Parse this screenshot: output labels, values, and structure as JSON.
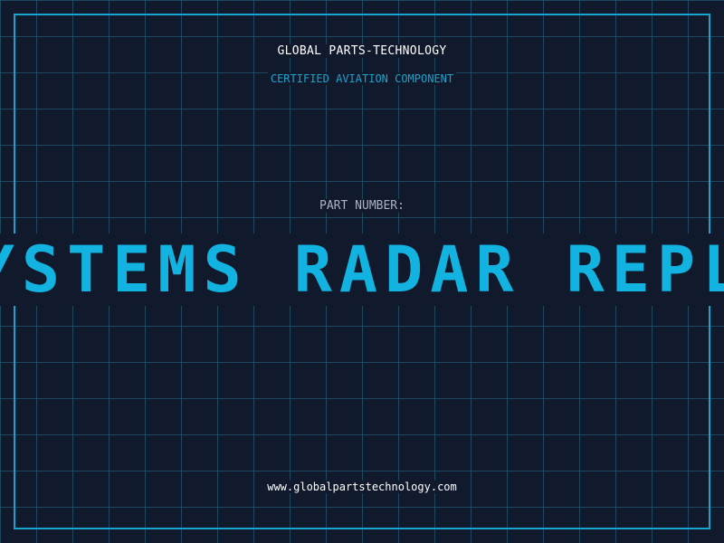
{
  "header": {
    "company": "GLOBAL PARTS-TECHNOLOGY",
    "tagline": "CERTIFIED AVIATION COMPONENT"
  },
  "part": {
    "label": "PART NUMBER:",
    "value": "SYSTEMS RADAR REPLA"
  },
  "footer": {
    "website": "www.globalpartstechnology.com"
  },
  "colors": {
    "background": "#111a2c",
    "accent": "#1aa3cc",
    "part_text": "#12b3e0",
    "grid": "#286e82"
  }
}
